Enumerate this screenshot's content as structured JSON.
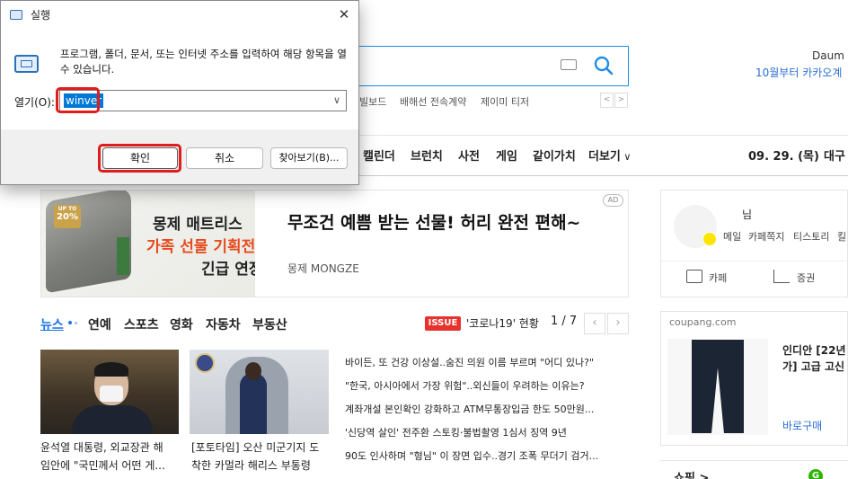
{
  "daum": {
    "brand_label": "Daum",
    "promo_text": "10월부터 카카오계",
    "hot_keywords": [
      "빌보드",
      "배해선 전속계약",
      "제이미 티저"
    ],
    "nav_items": [
      "캘린더",
      "브런치",
      "사전",
      "게임",
      "같이가치",
      "더보기"
    ],
    "nav_date": "09. 29. (목)",
    "nav_weather": "대구",
    "ad": {
      "badge": "20%",
      "badge_top": "UP TO",
      "brand_line1": "몽제 매트리스",
      "brand_line2": "가족 선물 기획전",
      "brand_line3": "긴급 연장!",
      "title": "무조건 예쁨 받는 선물! 허리 완전 편해~",
      "sub": "몽제 MONGZE",
      "ad_label": "AD"
    },
    "news_tabs": [
      "뉴스",
      "연예",
      "스포츠",
      "영화",
      "자동차",
      "부동산"
    ],
    "issue_badge": "ISSUE",
    "issue_text": "'코로나19' 현황",
    "pager": "1 / 7",
    "photo_captions": [
      [
        "윤석열 대통령, 외교장관 해",
        "임안에 \"국민께서 어떤 게..."
      ],
      [
        "[포토타임] 오산 미군기지 도",
        "착한 카멀라 해리스 부통령"
      ]
    ],
    "headlines": [
      "바이든, 또 건강 이상설..숨진 의원 이름 부르며 \"어디 있나?\"",
      "\"한국, 아시아에서 가장 위험\"..외신들이 우려하는 이유는?",
      "계좌개설 본인확인 강화하고 ATM무통장입금 한도 50만원...",
      "'신당역 살인' 전주환 스토킹·불법촬영 1심서 징역 9년",
      "90도 인사하며 \"형님\" 이 장면 입수..경기 조폭 무더기 검거..."
    ],
    "login": {
      "name": "님",
      "links": [
        "메일",
        "카페쪽지",
        "티스토리",
        "킬"
      ],
      "services": [
        "카페",
        "증권"
      ]
    },
    "coupang": {
      "label": "coupang.com",
      "product": "인디안 [22년 가] 고급 고신",
      "buy": "바로구매"
    },
    "shop_label": "쇼핑 >",
    "shop_badge": "G"
  },
  "run_dialog": {
    "title": "실행",
    "close": "✕",
    "description": "프로그램, 폴더, 문서, 또는 인터넷 주소를 입력하여 해당 항목을 열 수 있습니다.",
    "open_label": "열기(O):",
    "open_value": "winver",
    "ok_label": "확인",
    "cancel_label": "취소",
    "browse_label": "찾아보기(B)..."
  },
  "colors": {
    "accent_blue": "#1f8ce6",
    "highlight_red": "#e01c1c",
    "selection": "#0078d7"
  }
}
